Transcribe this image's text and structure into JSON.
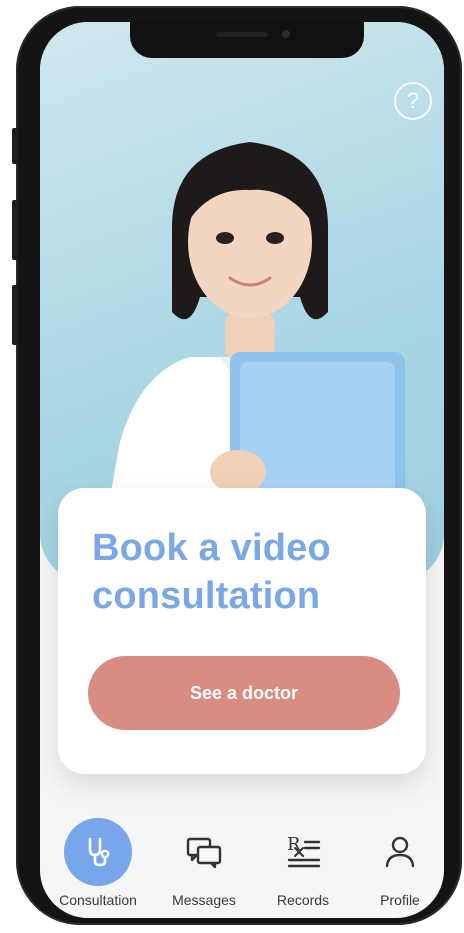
{
  "header": {
    "help_label": "?"
  },
  "card": {
    "title": "Book a video consultation",
    "cta_label": "See a doctor"
  },
  "tabbar": {
    "items": [
      {
        "label": "Consultation",
        "icon": "stethoscope-icon",
        "active": true
      },
      {
        "label": "Messages",
        "icon": "chat-bubbles-icon",
        "active": false
      },
      {
        "label": "Records",
        "icon": "prescription-icon",
        "active": false
      },
      {
        "label": "Profile",
        "icon": "user-icon",
        "active": false
      }
    ]
  },
  "colors": {
    "accent": "#77a7ea",
    "cta": "#d98d82",
    "title": "#7aa7e6",
    "hero_bg": "#a9d6e3"
  }
}
